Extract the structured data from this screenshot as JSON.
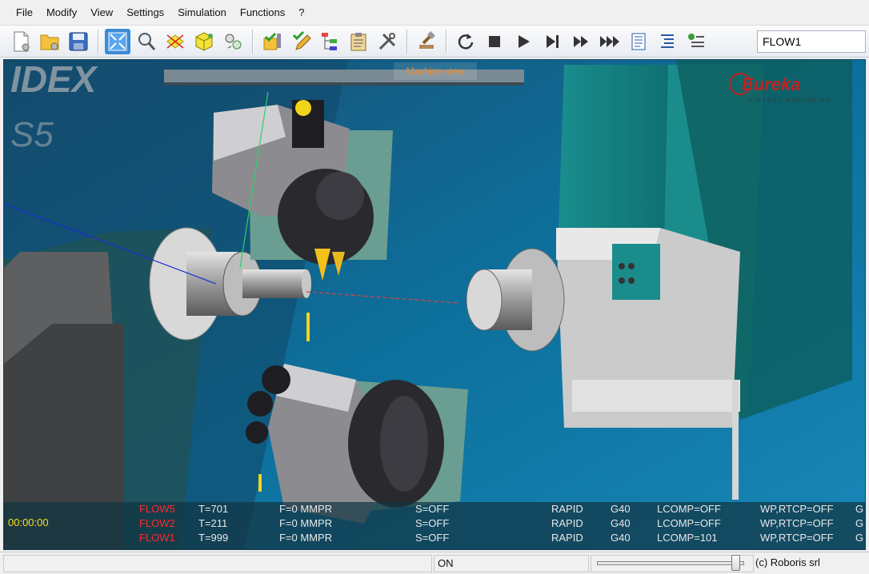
{
  "menu": [
    "File",
    "Modify",
    "View",
    "Settings",
    "Simulation",
    "Functions",
    "?"
  ],
  "toolbar": {
    "buttons": [
      "new-project-icon",
      "open-folder-icon",
      "save-icon",
      "fit-view-icon",
      "zoom-icon",
      "axes-icon",
      "cube-view-icon",
      "components-icon",
      "check-program-icon",
      "edit-program-icon",
      "tree-structure-icon",
      "clipboard-icon",
      "tools-icon",
      "hammer-icon",
      "reset-icon",
      "stop-icon",
      "play-icon",
      "step-icon",
      "fast-forward-icon",
      "fastest-forward-icon",
      "align-icon",
      "indent-icon",
      "checklist-icon"
    ],
    "flow_value": "FLOW1"
  },
  "viewport": {
    "tooltip": "Machine view",
    "machine_brand_partial": "IDEX",
    "machine_model_partial": "S5",
    "logo_text": "Eureka",
    "logo_sub": "VIRTUAL MACHINING"
  },
  "status": {
    "clock": "00:00:00",
    "rows": [
      {
        "flow": "FLOW5",
        "tool": "T=701",
        "feed": "F=0 MMPR",
        "spindle": "S=OFF",
        "mode": "RAPID",
        "g": "G40",
        "lcomp": "LCOMP=OFF",
        "wp": "WP,RTCP=OFF",
        "extra": "G"
      },
      {
        "flow": "FLOW2",
        "tool": "T=211",
        "feed": "F=0 MMPR",
        "spindle": "S=OFF",
        "mode": "RAPID",
        "g": "G40",
        "lcomp": "LCOMP=OFF",
        "wp": "WP,RTCP=OFF",
        "extra": "G"
      },
      {
        "flow": "FLOW1",
        "tool": "T=999",
        "feed": "F=0 MMPR",
        "spindle": "S=OFF",
        "mode": "RAPID",
        "g": "G40",
        "lcomp": "LCOMP=101",
        "wp": "WP,RTCP=OFF",
        "extra": "G"
      }
    ]
  },
  "statusbar": {
    "state": "ON",
    "copyright": "(c) Roboris srl",
    "speed_fraction": 0.97
  },
  "colors": {
    "background": "#106a93",
    "flow_label": "#ff2a2a",
    "clock": "#f2e020",
    "tooltip": "#f08b2b"
  }
}
